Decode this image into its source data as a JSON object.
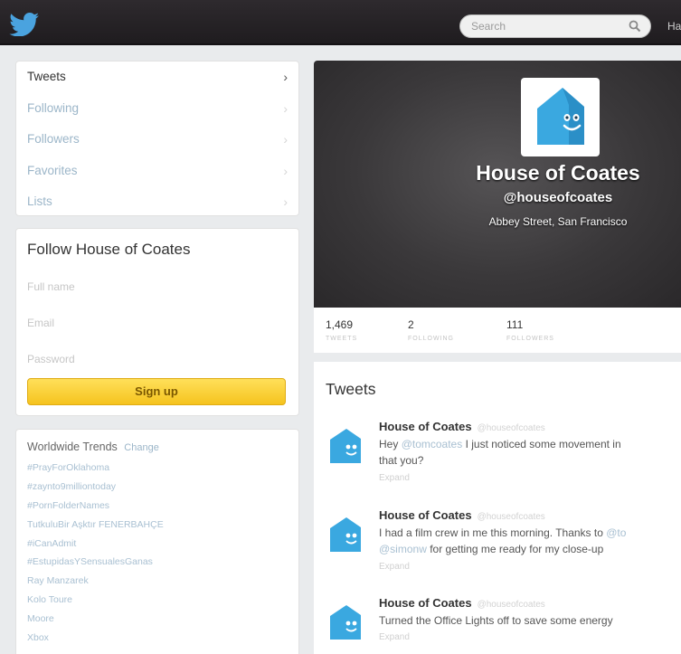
{
  "topbar": {
    "search_placeholder": "Search",
    "nav_partial": "Ha"
  },
  "sidebar": {
    "items": [
      {
        "label": "Tweets",
        "active": true
      },
      {
        "label": "Following"
      },
      {
        "label": "Followers"
      },
      {
        "label": "Favorites"
      },
      {
        "label": "Lists"
      }
    ],
    "chevron": "›"
  },
  "signup_box": {
    "title": "Follow House of Coates",
    "full_name_placeholder": "Full name",
    "email_placeholder": "Email",
    "password_placeholder": "Password",
    "button_label": "Sign up"
  },
  "trends": {
    "title": "Worldwide Trends",
    "change_label": "Change",
    "items": [
      "#PrayForOklahoma",
      "#zaynto9milliontoday",
      "#PornFolderNames",
      "TutkuluBir Aşktır FENERBAHÇE",
      "#iCanAdmit",
      "#EstupidasYSensualesGanas",
      "Ray Manzarek",
      "Kolo Toure",
      "Moore",
      "Xbox"
    ]
  },
  "profile": {
    "name": "House of Coates",
    "handle": "@houseofcoates",
    "location": "Abbey Street, San Francisco",
    "stats": [
      {
        "value": "1,469",
        "label": "TWEETS"
      },
      {
        "value": "2",
        "label": "FOLLOWING"
      },
      {
        "value": "111",
        "label": "FOLLOWERS"
      }
    ]
  },
  "stream": {
    "title": "Tweets",
    "tweets": [
      {
        "name": "House of Coates",
        "screen_name": "@houseofcoates",
        "pre": "Hey ",
        "mention": "@tomcoates",
        "post": " I just noticed some movement in",
        "line2": "that you?",
        "expand": "Expand"
      },
      {
        "name": "House of Coates",
        "screen_name": "@houseofcoates",
        "pre": "I had a film crew in me this morning. Thanks to ",
        "mention": "@to",
        "mention2": "@simonw",
        "post2": " for getting me ready for my close-up",
        "expand": "Expand"
      },
      {
        "name": "House of Coates",
        "screen_name": "@houseofcoates",
        "pre": "Turned the Office Lights off to save some energy",
        "expand": "Expand"
      }
    ]
  },
  "colors": {
    "link": "#a9c0d2",
    "button_yellow": "#f5c31e",
    "house_blue": "#3aa8e0",
    "twitter_blue": "#4aa3df"
  }
}
